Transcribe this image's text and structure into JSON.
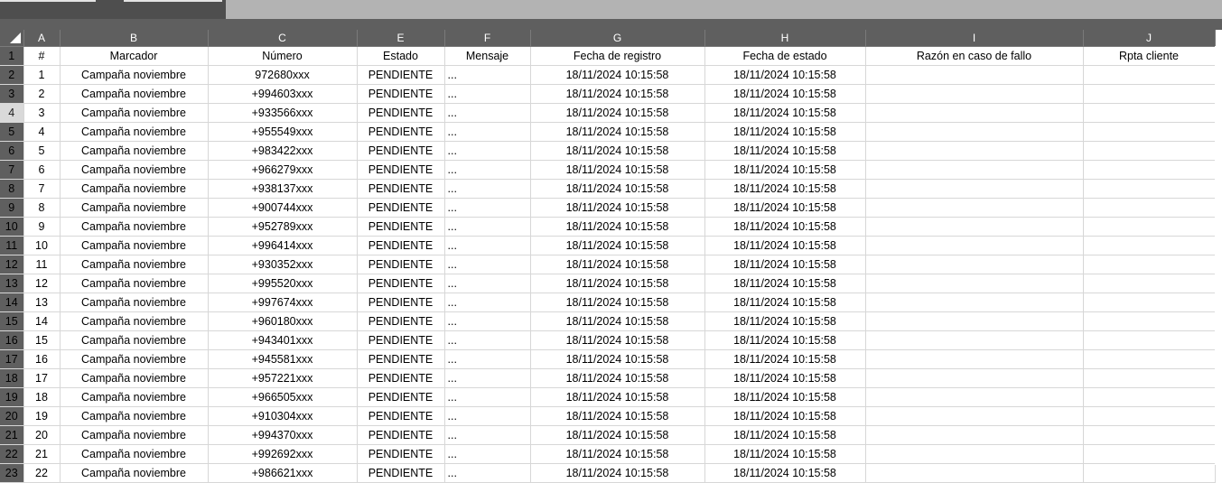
{
  "sheet": {
    "columns": [
      "A",
      "B",
      "C",
      "E",
      "F",
      "G",
      "H",
      "I",
      "J"
    ],
    "headers": [
      "#",
      "Marcador",
      "Número",
      "Estado",
      "Mensaje",
      "Fecha de registro",
      "Fecha de estado",
      "Razón en caso de fallo",
      "Rpta cliente"
    ],
    "selected_row_header": "4",
    "rows": [
      {
        "row": "2",
        "num": "1",
        "marcador": "Campaña noviembre",
        "numero": "972680xxx",
        "estado": "PENDIENTE",
        "mensaje": "...",
        "fecha_registro": "18/11/2024 10:15:58",
        "fecha_estado": "18/11/2024 10:15:58",
        "razon": "",
        "rpta": ""
      },
      {
        "row": "3",
        "num": "2",
        "marcador": "Campaña noviembre",
        "numero": "+994603xxx",
        "estado": "PENDIENTE",
        "mensaje": "...",
        "fecha_registro": "18/11/2024 10:15:58",
        "fecha_estado": "18/11/2024 10:15:58",
        "razon": "",
        "rpta": ""
      },
      {
        "row": "4",
        "num": "3",
        "marcador": "Campaña noviembre",
        "numero": "+933566xxx",
        "estado": "PENDIENTE",
        "mensaje": "...",
        "fecha_registro": "18/11/2024 10:15:58",
        "fecha_estado": "18/11/2024 10:15:58",
        "razon": "",
        "rpta": ""
      },
      {
        "row": "5",
        "num": "4",
        "marcador": "Campaña noviembre",
        "numero": "+955549xxx",
        "estado": "PENDIENTE",
        "mensaje": "...",
        "fecha_registro": "18/11/2024 10:15:58",
        "fecha_estado": "18/11/2024 10:15:58",
        "razon": "",
        "rpta": ""
      },
      {
        "row": "6",
        "num": "5",
        "marcador": "Campaña noviembre",
        "numero": "+983422xxx",
        "estado": "PENDIENTE",
        "mensaje": "...",
        "fecha_registro": "18/11/2024 10:15:58",
        "fecha_estado": "18/11/2024 10:15:58",
        "razon": "",
        "rpta": ""
      },
      {
        "row": "7",
        "num": "6",
        "marcador": "Campaña noviembre",
        "numero": "+966279xxx",
        "estado": "PENDIENTE",
        "mensaje": "...",
        "fecha_registro": "18/11/2024 10:15:58",
        "fecha_estado": "18/11/2024 10:15:58",
        "razon": "",
        "rpta": ""
      },
      {
        "row": "8",
        "num": "7",
        "marcador": "Campaña noviembre",
        "numero": "+938137xxx",
        "estado": "PENDIENTE",
        "mensaje": "...",
        "fecha_registro": "18/11/2024 10:15:58",
        "fecha_estado": "18/11/2024 10:15:58",
        "razon": "",
        "rpta": ""
      },
      {
        "row": "9",
        "num": "8",
        "marcador": "Campaña noviembre",
        "numero": "+900744xxx",
        "estado": "PENDIENTE",
        "mensaje": "...",
        "fecha_registro": "18/11/2024 10:15:58",
        "fecha_estado": "18/11/2024 10:15:58",
        "razon": "",
        "rpta": ""
      },
      {
        "row": "10",
        "num": "9",
        "marcador": "Campaña noviembre",
        "numero": "+952789xxx",
        "estado": "PENDIENTE",
        "mensaje": "...",
        "fecha_registro": "18/11/2024 10:15:58",
        "fecha_estado": "18/11/2024 10:15:58",
        "razon": "",
        "rpta": ""
      },
      {
        "row": "11",
        "num": "10",
        "marcador": "Campaña noviembre",
        "numero": "+996414xxx",
        "estado": "PENDIENTE",
        "mensaje": "...",
        "fecha_registro": "18/11/2024 10:15:58",
        "fecha_estado": "18/11/2024 10:15:58",
        "razon": "",
        "rpta": ""
      },
      {
        "row": "12",
        "num": "11",
        "marcador": "Campaña noviembre",
        "numero": "+930352xxx",
        "estado": "PENDIENTE",
        "mensaje": "...",
        "fecha_registro": "18/11/2024 10:15:58",
        "fecha_estado": "18/11/2024 10:15:58",
        "razon": "",
        "rpta": ""
      },
      {
        "row": "13",
        "num": "12",
        "marcador": "Campaña noviembre",
        "numero": "+995520xxx",
        "estado": "PENDIENTE",
        "mensaje": "...",
        "fecha_registro": "18/11/2024 10:15:58",
        "fecha_estado": "18/11/2024 10:15:58",
        "razon": "",
        "rpta": ""
      },
      {
        "row": "14",
        "num": "13",
        "marcador": "Campaña noviembre",
        "numero": "+997674xxx",
        "estado": "PENDIENTE",
        "mensaje": "...",
        "fecha_registro": "18/11/2024 10:15:58",
        "fecha_estado": "18/11/2024 10:15:58",
        "razon": "",
        "rpta": ""
      },
      {
        "row": "15",
        "num": "14",
        "marcador": "Campaña noviembre",
        "numero": "+960180xxx",
        "estado": "PENDIENTE",
        "mensaje": "...",
        "fecha_registro": "18/11/2024 10:15:58",
        "fecha_estado": "18/11/2024 10:15:58",
        "razon": "",
        "rpta": ""
      },
      {
        "row": "16",
        "num": "15",
        "marcador": "Campaña noviembre",
        "numero": "+943401xxx",
        "estado": "PENDIENTE",
        "mensaje": "...",
        "fecha_registro": "18/11/2024 10:15:58",
        "fecha_estado": "18/11/2024 10:15:58",
        "razon": "",
        "rpta": ""
      },
      {
        "row": "17",
        "num": "16",
        "marcador": "Campaña noviembre",
        "numero": "+945581xxx",
        "estado": "PENDIENTE",
        "mensaje": "...",
        "fecha_registro": "18/11/2024 10:15:58",
        "fecha_estado": "18/11/2024 10:15:58",
        "razon": "",
        "rpta": ""
      },
      {
        "row": "18",
        "num": "17",
        "marcador": "Campaña noviembre",
        "numero": "+957221xxx",
        "estado": "PENDIENTE",
        "mensaje": "...",
        "fecha_registro": "18/11/2024 10:15:58",
        "fecha_estado": "18/11/2024 10:15:58",
        "razon": "",
        "rpta": ""
      },
      {
        "row": "19",
        "num": "18",
        "marcador": "Campaña noviembre",
        "numero": "+966505xxx",
        "estado": "PENDIENTE",
        "mensaje": "...",
        "fecha_registro": "18/11/2024 10:15:58",
        "fecha_estado": "18/11/2024 10:15:58",
        "razon": "",
        "rpta": ""
      },
      {
        "row": "20",
        "num": "19",
        "marcador": "Campaña noviembre",
        "numero": "+910304xxx",
        "estado": "PENDIENTE",
        "mensaje": "...",
        "fecha_registro": "18/11/2024 10:15:58",
        "fecha_estado": "18/11/2024 10:15:58",
        "razon": "",
        "rpta": ""
      },
      {
        "row": "21",
        "num": "20",
        "marcador": "Campaña noviembre",
        "numero": "+994370xxx",
        "estado": "PENDIENTE",
        "mensaje": "...",
        "fecha_registro": "18/11/2024 10:15:58",
        "fecha_estado": "18/11/2024 10:15:58",
        "razon": "",
        "rpta": ""
      },
      {
        "row": "22",
        "num": "21",
        "marcador": "Campaña noviembre",
        "numero": "+992692xxx",
        "estado": "PENDIENTE",
        "mensaje": "...",
        "fecha_registro": "18/11/2024 10:15:58",
        "fecha_estado": "18/11/2024 10:15:58",
        "razon": "",
        "rpta": ""
      },
      {
        "row": "23",
        "num": "22",
        "marcador": "Campaña noviembre",
        "numero": "+986621xxx",
        "estado": "PENDIENTE",
        "mensaje": "...",
        "fecha_registro": "18/11/2024 10:15:58",
        "fecha_estado": "18/11/2024 10:15:58",
        "razon": "",
        "rpta": ""
      }
    ]
  },
  "colors": {
    "header_bg": "#5f5f5f",
    "selected_row_header_bg": "#d9d9d9",
    "gridline": "#d7d7d7"
  },
  "icons": {
    "select_all": "select-all-triangle-icon"
  }
}
